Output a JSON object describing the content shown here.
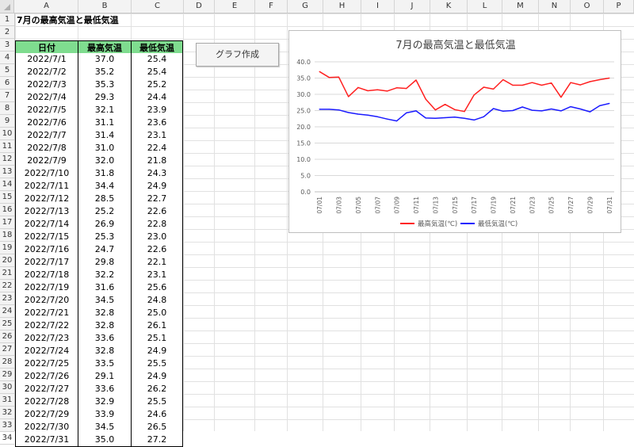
{
  "sheet": {
    "columns": [
      "A",
      "B",
      "C",
      "D",
      "E",
      "F",
      "G",
      "H",
      "I",
      "J",
      "K",
      "L",
      "M",
      "N",
      "O",
      "P"
    ],
    "rows": [
      "1",
      "2",
      "3",
      "4",
      "5",
      "6",
      "7",
      "8",
      "9",
      "10",
      "11",
      "12",
      "13",
      "14",
      "15",
      "16",
      "17",
      "18",
      "19",
      "20",
      "21",
      "22",
      "23",
      "24",
      "25",
      "26",
      "27",
      "28",
      "29",
      "30",
      "31",
      "32",
      "33",
      "34"
    ],
    "title": "7月の最高気温と最低気温"
  },
  "table": {
    "headers": [
      "日付",
      "最高気温(℃)",
      "最低気温(℃)"
    ],
    "rows": [
      [
        "2022/7/1",
        "37.0",
        "25.4"
      ],
      [
        "2022/7/2",
        "35.2",
        "25.4"
      ],
      [
        "2022/7/3",
        "35.3",
        "25.2"
      ],
      [
        "2022/7/4",
        "29.3",
        "24.4"
      ],
      [
        "2022/7/5",
        "32.1",
        "23.9"
      ],
      [
        "2022/7/6",
        "31.1",
        "23.6"
      ],
      [
        "2022/7/7",
        "31.4",
        "23.1"
      ],
      [
        "2022/7/8",
        "31.0",
        "22.4"
      ],
      [
        "2022/7/9",
        "32.0",
        "21.8"
      ],
      [
        "2022/7/10",
        "31.8",
        "24.3"
      ],
      [
        "2022/7/11",
        "34.4",
        "24.9"
      ],
      [
        "2022/7/12",
        "28.5",
        "22.7"
      ],
      [
        "2022/7/13",
        "25.2",
        "22.6"
      ],
      [
        "2022/7/14",
        "26.9",
        "22.8"
      ],
      [
        "2022/7/15",
        "25.3",
        "23.0"
      ],
      [
        "2022/7/16",
        "24.7",
        "22.6"
      ],
      [
        "2022/7/17",
        "29.8",
        "22.1"
      ],
      [
        "2022/7/18",
        "32.2",
        "23.1"
      ],
      [
        "2022/7/19",
        "31.6",
        "25.6"
      ],
      [
        "2022/7/20",
        "34.5",
        "24.8"
      ],
      [
        "2022/7/21",
        "32.8",
        "25.0"
      ],
      [
        "2022/7/22",
        "32.8",
        "26.1"
      ],
      [
        "2022/7/23",
        "33.6",
        "25.1"
      ],
      [
        "2022/7/24",
        "32.8",
        "24.9"
      ],
      [
        "2022/7/25",
        "33.5",
        "25.5"
      ],
      [
        "2022/7/26",
        "29.1",
        "24.9"
      ],
      [
        "2022/7/27",
        "33.6",
        "26.2"
      ],
      [
        "2022/7/28",
        "32.9",
        "25.5"
      ],
      [
        "2022/7/29",
        "33.9",
        "24.6"
      ],
      [
        "2022/7/30",
        "34.5",
        "26.5"
      ],
      [
        "2022/7/31",
        "35.0",
        "27.2"
      ]
    ]
  },
  "button": {
    "label": "グラフ作成"
  },
  "chart_data": {
    "type": "line",
    "title": "7月の最高気温と最低気温",
    "xlabel": "",
    "ylabel": "",
    "ylim": [
      0,
      40
    ],
    "yticks": [
      "0.0",
      "5.0",
      "10.0",
      "15.0",
      "20.0",
      "25.0",
      "30.0",
      "35.0",
      "40.0"
    ],
    "x": [
      "07/01",
      "07/02",
      "07/03",
      "07/04",
      "07/05",
      "07/06",
      "07/07",
      "07/08",
      "07/09",
      "07/10",
      "07/11",
      "07/12",
      "07/13",
      "07/14",
      "07/15",
      "07/16",
      "07/17",
      "07/18",
      "07/19",
      "07/20",
      "07/21",
      "07/22",
      "07/23",
      "07/24",
      "07/25",
      "07/26",
      "07/27",
      "07/28",
      "07/29",
      "07/30",
      "07/31"
    ],
    "xtick_labels": [
      "07/01",
      "07/03",
      "07/05",
      "07/07",
      "07/09",
      "07/11",
      "07/13",
      "07/15",
      "07/17",
      "07/19",
      "07/21",
      "07/23",
      "07/25",
      "07/27",
      "07/29",
      "07/31"
    ],
    "grid": true,
    "legend": "bottom",
    "series": [
      {
        "name": "最高気温(℃)",
        "color": "#ff2020",
        "values": [
          37.0,
          35.2,
          35.3,
          29.3,
          32.1,
          31.1,
          31.4,
          31.0,
          32.0,
          31.8,
          34.4,
          28.5,
          25.2,
          26.9,
          25.3,
          24.7,
          29.8,
          32.2,
          31.6,
          34.5,
          32.8,
          32.8,
          33.6,
          32.8,
          33.5,
          29.1,
          33.6,
          32.9,
          33.9,
          34.5,
          35.0
        ]
      },
      {
        "name": "最低気温(℃)",
        "color": "#1a1aff",
        "values": [
          25.4,
          25.4,
          25.2,
          24.4,
          23.9,
          23.6,
          23.1,
          22.4,
          21.8,
          24.3,
          24.9,
          22.7,
          22.6,
          22.8,
          23.0,
          22.6,
          22.1,
          23.1,
          25.6,
          24.8,
          25.0,
          26.1,
          25.1,
          24.9,
          25.5,
          24.9,
          26.2,
          25.5,
          24.6,
          26.5,
          27.2
        ]
      }
    ]
  }
}
